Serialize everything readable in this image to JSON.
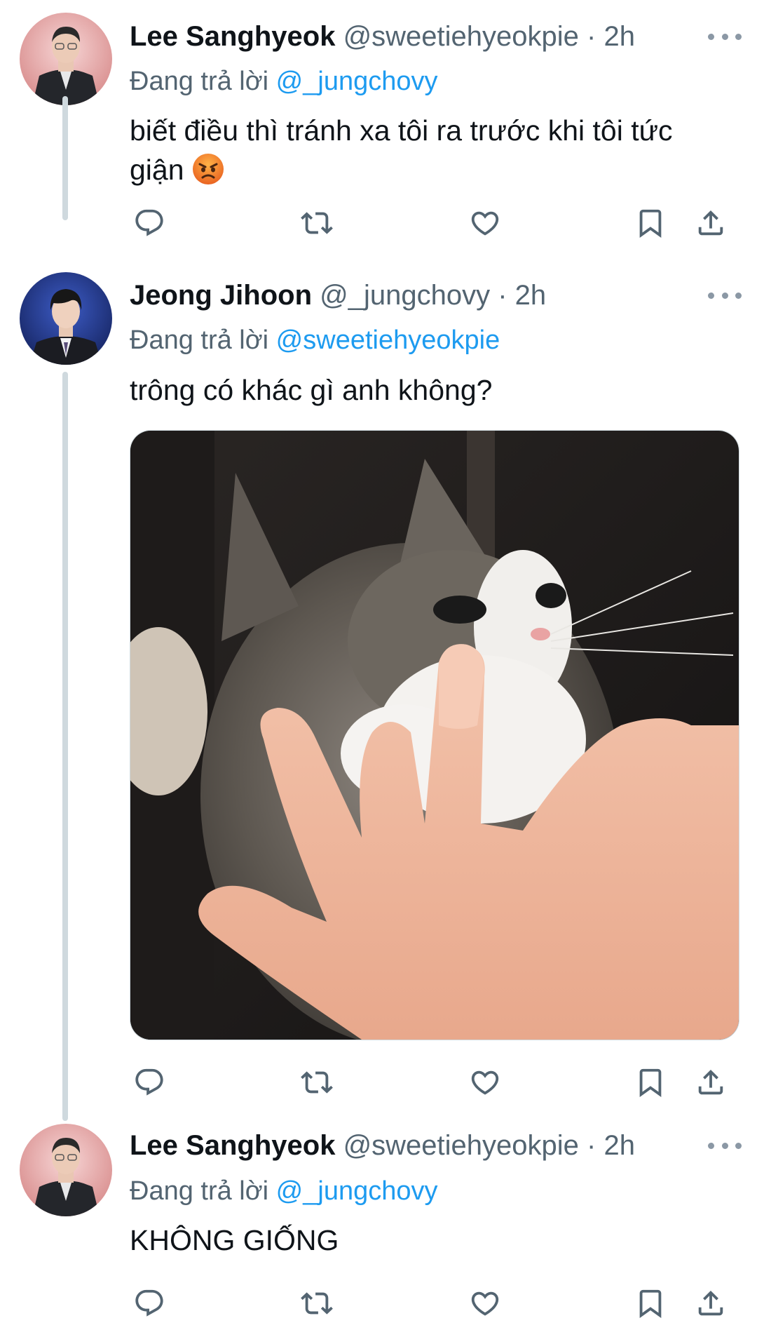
{
  "tweets": [
    {
      "name": "Lee Sanghyeok",
      "handle": "@sweetiehyeokpie",
      "dot": "·",
      "time": "2h",
      "reply_prefix": "Đang trả lời",
      "reply_to": "@_jungchovy",
      "text": "biết điều thì tránh xa tôi ra trước khi tôi tức giận",
      "emoji": "angry-face-emoji"
    },
    {
      "name": "Jeong Jihoon",
      "handle": "@_jungchovy",
      "dot": "·",
      "time": "2h",
      "reply_prefix": "Đang trả lời",
      "reply_to": "@sweetiehyeokpie",
      "text": "trông có khác gì anh không?",
      "media": "kitten-biting-finger-photo"
    },
    {
      "name": "Lee Sanghyeok",
      "handle": "@sweetiehyeokpie",
      "dot": "·",
      "time": "2h",
      "reply_prefix": "Đang trả lời",
      "reply_to": "@_jungchovy",
      "text": "KHÔNG GIỐNG"
    }
  ],
  "icons": {
    "reply": "reply-icon",
    "retweet": "retweet-icon",
    "like": "heart-icon",
    "bookmark": "bookmark-icon",
    "share": "share-icon",
    "more": "more-icon"
  },
  "colors": {
    "link": "#1d9bf0",
    "muted": "#536471",
    "text": "#0f1419",
    "line": "#cfd9de"
  }
}
